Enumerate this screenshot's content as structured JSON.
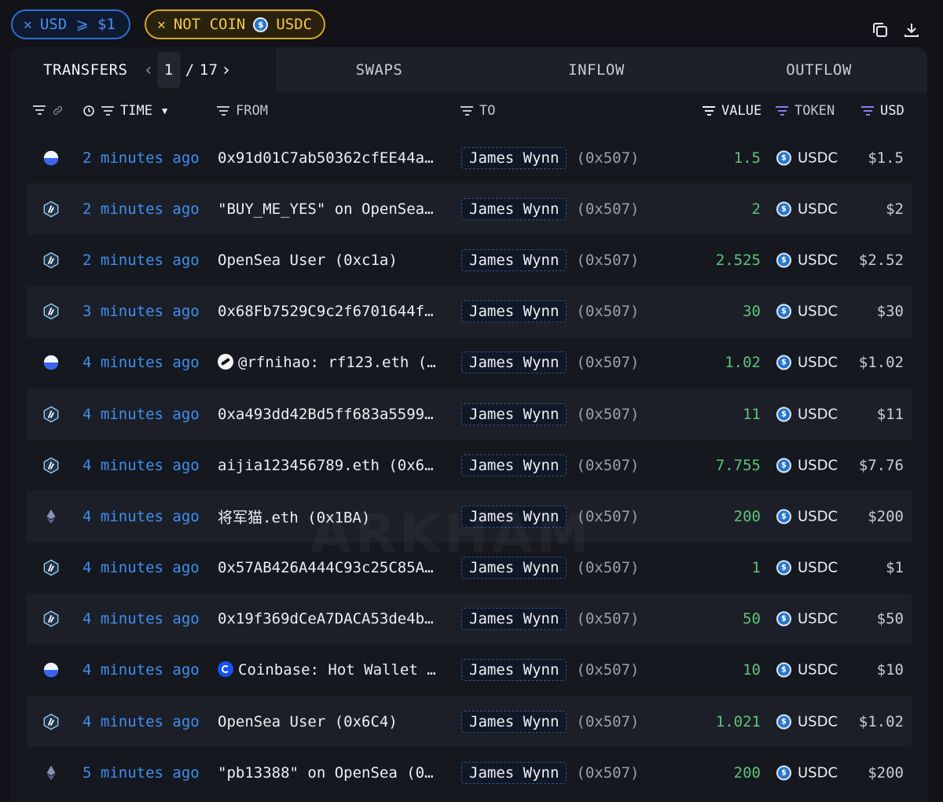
{
  "filters": {
    "usd_label": "USD ⩾ $1",
    "coin_prefix": "NOT COIN",
    "coin_label": "USDC"
  },
  "tabs": {
    "transfers": "TRANSFERS",
    "page_current": "1",
    "page_sep": "/",
    "page_total": "17",
    "swaps": "SWAPS",
    "inflow": "INFLOW",
    "outflow": "OUTFLOW"
  },
  "columns": {
    "time": "TIME",
    "from": "FROM",
    "to": "TO",
    "value": "VALUE",
    "token": "TOKEN",
    "usd": "USD"
  },
  "watermark": "ARKHAM",
  "rows": [
    {
      "chain": "base",
      "time": "2 minutes ago",
      "from": "0x91d01C7ab50362cfEE44a…",
      "from_icon": "",
      "to_name": "James Wynn",
      "to_addr": "(0x507)",
      "value": "1.5",
      "token": "USDC",
      "usd": "$1.5"
    },
    {
      "chain": "arbitrum",
      "time": "2 minutes ago",
      "from": "\"BUY_ME_YES\" on OpenSea…",
      "from_icon": "",
      "to_name": "James Wynn",
      "to_addr": "(0x507)",
      "value": "2",
      "token": "USDC",
      "usd": "$2"
    },
    {
      "chain": "arbitrum",
      "time": "2 minutes ago",
      "from": "OpenSea User (0xc1a)",
      "from_icon": "",
      "to_name": "James Wynn",
      "to_addr": "(0x507)",
      "value": "2.525",
      "token": "USDC",
      "usd": "$2.52"
    },
    {
      "chain": "arbitrum",
      "time": "3 minutes ago",
      "from": "0x68Fb7529C9c2f6701644f…",
      "from_icon": "",
      "to_name": "James Wynn",
      "to_addr": "(0x507)",
      "value": "30",
      "token": "USDC",
      "usd": "$30"
    },
    {
      "chain": "base",
      "time": "4 minutes ago",
      "from": "@rfnihao: rf123.eth (…",
      "from_icon": "white",
      "to_name": "James Wynn",
      "to_addr": "(0x507)",
      "value": "1.02",
      "token": "USDC",
      "usd": "$1.02"
    },
    {
      "chain": "arbitrum",
      "time": "4 minutes ago",
      "from": "0xa493dd42Bd5ff683a5599…",
      "from_icon": "",
      "to_name": "James Wynn",
      "to_addr": "(0x507)",
      "value": "11",
      "token": "USDC",
      "usd": "$11"
    },
    {
      "chain": "arbitrum",
      "time": "4 minutes ago",
      "from": "aijia123456789.eth (0x6…",
      "from_icon": "",
      "to_name": "James Wynn",
      "to_addr": "(0x507)",
      "value": "7.755",
      "token": "USDC",
      "usd": "$7.76"
    },
    {
      "chain": "ethereum",
      "time": "4 minutes ago",
      "from": "将军猫.eth (0x1BA)",
      "from_icon": "",
      "to_name": "James Wynn",
      "to_addr": "(0x507)",
      "value": "200",
      "token": "USDC",
      "usd": "$200"
    },
    {
      "chain": "arbitrum",
      "time": "4 minutes ago",
      "from": "0x57AB426A444C93c25C85A…",
      "from_icon": "",
      "to_name": "James Wynn",
      "to_addr": "(0x507)",
      "value": "1",
      "token": "USDC",
      "usd": "$1"
    },
    {
      "chain": "arbitrum",
      "time": "4 minutes ago",
      "from": "0x19f369dCeA7DACA53de4b…",
      "from_icon": "",
      "to_name": "James Wynn",
      "to_addr": "(0x507)",
      "value": "50",
      "token": "USDC",
      "usd": "$50"
    },
    {
      "chain": "base",
      "time": "4 minutes ago",
      "from": "Coinbase: Hot Wallet …",
      "from_icon": "coinbase",
      "to_name": "James Wynn",
      "to_addr": "(0x507)",
      "value": "10",
      "token": "USDC",
      "usd": "$10"
    },
    {
      "chain": "arbitrum",
      "time": "4 minutes ago",
      "from": "OpenSea User (0x6C4)",
      "from_icon": "",
      "to_name": "James Wynn",
      "to_addr": "(0x507)",
      "value": "1.021",
      "token": "USDC",
      "usd": "$1.02"
    },
    {
      "chain": "ethereum",
      "time": "5 minutes ago",
      "from": "\"pb13388\" on OpenSea (0…",
      "from_icon": "",
      "to_name": "James Wynn",
      "to_addr": "(0x507)",
      "value": "200",
      "token": "USDC",
      "usd": "$200"
    }
  ]
}
